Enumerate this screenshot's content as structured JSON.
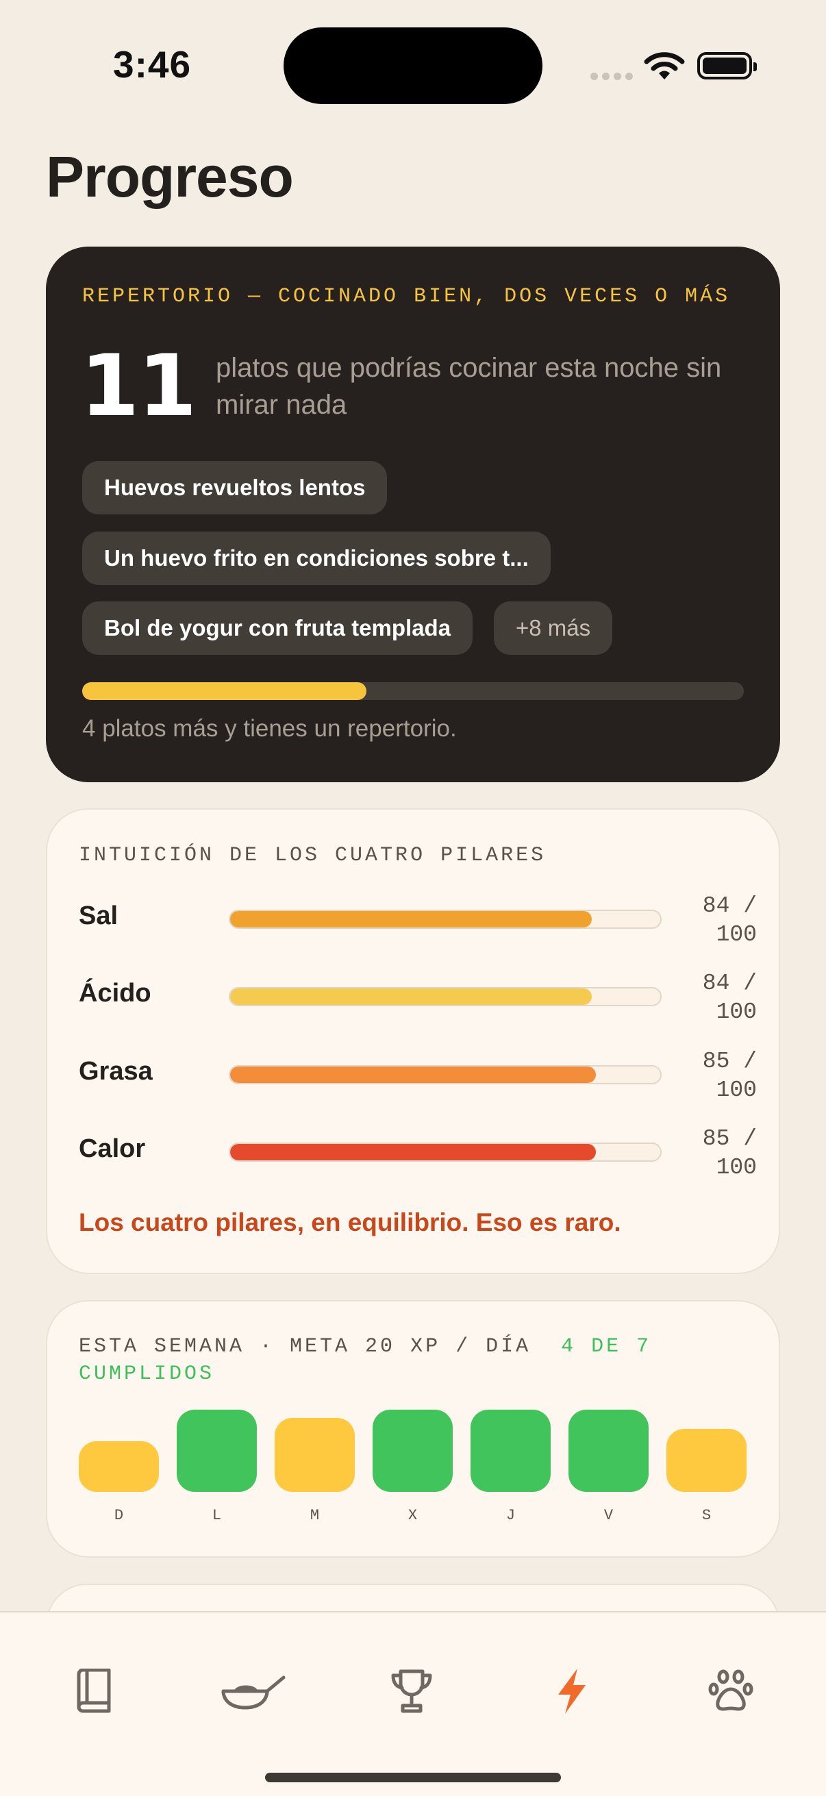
{
  "status_bar": {
    "time": "3:46"
  },
  "page_title": "Progreso",
  "repertoire": {
    "eyebrow": "REPERTORIO — COCINADO BIEN, DOS VECES O MÁS",
    "count": "11",
    "description": "platos que podrías cocinar esta noche sin mirar nada",
    "dishes": [
      "Huevos revueltos lentos",
      "Un huevo frito en condiciones sobre t...",
      "Bol de yogur con fruta templada"
    ],
    "more_chip": "+8 más",
    "progress_fraction": 0.43,
    "note": "4 platos más y tienes un repertorio.",
    "accent_color": "#f6c43d"
  },
  "pillars": {
    "eyebrow": "INTUICIÓN DE LOS CUATRO PILARES",
    "items": [
      {
        "name": "Sal",
        "score_value": "84 /",
        "score_max": "100",
        "value": 84,
        "color": "#f0a22e"
      },
      {
        "name": "Ácido",
        "score_value": "84 /",
        "score_max": "100",
        "value": 84,
        "color": "#f4cb4f"
      },
      {
        "name": "Grasa",
        "score_value": "85 /",
        "score_max": "100",
        "value": 85,
        "color": "#f38d3a"
      },
      {
        "name": "Calor",
        "score_value": "85 /",
        "score_max": "100",
        "value": 85,
        "color": "#e54a2c"
      }
    ],
    "note": "Los cuatro pilares, en equilibrio. Eso es raro."
  },
  "week": {
    "eyebrow_main": "ESTA SEMANA · META 20 XP / DÍA",
    "eyebrow_done": "4 DE 7 CUMPLIDOS",
    "days": [
      {
        "label": "D",
        "level": 0.62,
        "met": false
      },
      {
        "label": "L",
        "level": 1.0,
        "met": true
      },
      {
        "label": "M",
        "level": 0.9,
        "met": false
      },
      {
        "label": "X",
        "level": 1.0,
        "met": true
      },
      {
        "label": "J",
        "level": 1.0,
        "met": true
      },
      {
        "label": "V",
        "level": 1.0,
        "met": true
      },
      {
        "label": "S",
        "level": 0.77,
        "met": false
      }
    ],
    "met_color": "#42c45d",
    "unmet_color": "#fec93e"
  },
  "tab_bar": {
    "tabs": [
      {
        "icon": "book-icon",
        "active": false
      },
      {
        "icon": "pan-icon",
        "active": false
      },
      {
        "icon": "trophy-icon",
        "active": false
      },
      {
        "icon": "bolt-icon",
        "active": true
      },
      {
        "icon": "paw-icon",
        "active": false
      }
    ],
    "active_color": "#f06a2a",
    "inactive_color": "#6f6761"
  }
}
